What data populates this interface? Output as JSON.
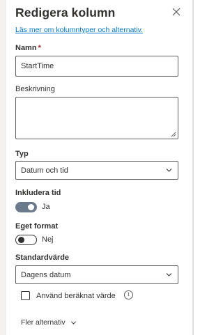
{
  "panel": {
    "title": "Redigera kolumn",
    "learn_more_link": "Läs mer om kolumntyper och alternativ."
  },
  "fields": {
    "name": {
      "label": "Namn",
      "required_mark": "*",
      "value": "StartTime"
    },
    "description": {
      "label": "Beskrivning",
      "value": ""
    },
    "type": {
      "label": "Typ",
      "selected": "Datum och tid"
    },
    "include_time": {
      "label": "Inkludera tid",
      "state_label": "Ja",
      "on": true
    },
    "custom_format": {
      "label": "Eget format",
      "state_label": "Nej",
      "on": false
    },
    "default_value": {
      "label": "Standardvärde",
      "selected": "Dagens datum"
    },
    "calculated": {
      "label": "Använd beräknat värde",
      "checked": false
    }
  },
  "more_options": {
    "label": "Fler alternativ"
  },
  "icons": {
    "close": "close-icon",
    "info": "info-icon",
    "chevron": "chevron-down-icon"
  },
  "colors": {
    "link": "#0078d4",
    "required": "#a4262c",
    "toggle_on": "#6b7a8a",
    "text": "#323130"
  }
}
